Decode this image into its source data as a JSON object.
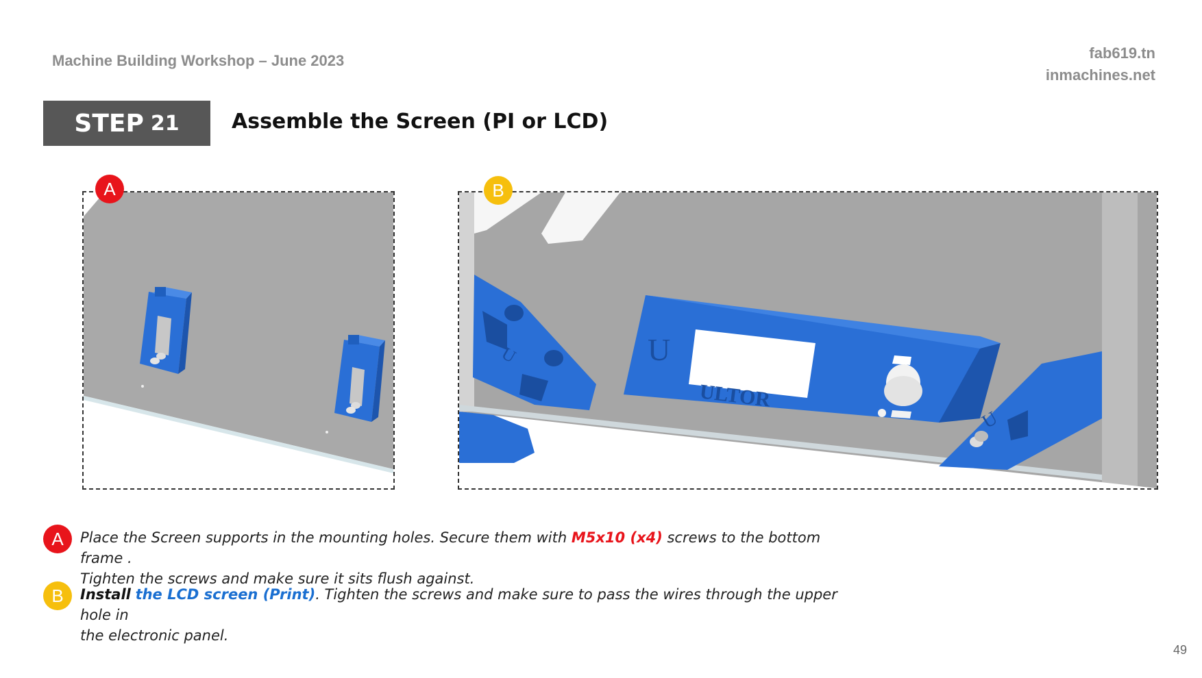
{
  "header": {
    "workshop_title": "Machine Building Workshop – June 2023",
    "site_1": "fab619.tn",
    "site_2": "inmachines.net"
  },
  "step": {
    "word": "STEP",
    "number": "21",
    "title": "Assemble the Screen (PI or LCD)"
  },
  "figures": {
    "a_label": "A",
    "b_label": "B",
    "screen_brand": "ULTOR",
    "logo_letter": "U"
  },
  "instructions": {
    "a": {
      "marker": "A",
      "text_1": "Place the Screen supports in the mounting holes. Secure them with ",
      "highlight": "M5x10 (x4)",
      "text_2": "  screws to the bottom frame .",
      "line_2": "Tighten the screws and make sure it sits flush against."
    },
    "b": {
      "marker": "B",
      "bold": "Install",
      "link": "the LCD screen (Print)",
      "text_1": ". Tighten the screws and make sure to pass the wires through the upper hole in",
      "line_2": "the electronic panel."
    }
  },
  "colors": {
    "marker_a": "#e8141b",
    "marker_b": "#f6bf0d",
    "part_blue": "#2a6fd6",
    "link_blue": "#1a6fd1",
    "step_box": "#575757"
  },
  "page_number": "49"
}
